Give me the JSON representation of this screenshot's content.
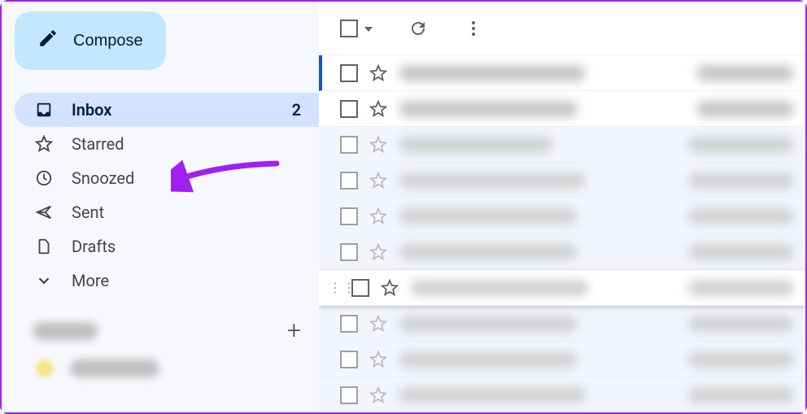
{
  "compose": {
    "label": "Compose"
  },
  "nav": {
    "items": [
      {
        "id": "inbox",
        "label": "Inbox",
        "count": "2",
        "active": true,
        "icon": "inbox-icon"
      },
      {
        "id": "starred",
        "label": "Starred",
        "count": "",
        "active": false,
        "icon": "star-icon"
      },
      {
        "id": "snoozed",
        "label": "Snoozed",
        "count": "",
        "active": false,
        "icon": "clock-icon"
      },
      {
        "id": "sent",
        "label": "Sent",
        "count": "",
        "active": false,
        "icon": "send-icon"
      },
      {
        "id": "drafts",
        "label": "Drafts",
        "count": "",
        "active": false,
        "icon": "file-icon"
      },
      {
        "id": "more",
        "label": "More",
        "count": "",
        "active": false,
        "icon": "chevron-down-icon"
      }
    ]
  },
  "annotation": {
    "target": "snoozed",
    "color": "#a020f0"
  },
  "messages": {
    "rows": [
      {
        "unread": true,
        "highlighted": true,
        "hovered": false,
        "senderWidth": 230,
        "subjectWidth": 120
      },
      {
        "unread": true,
        "highlighted": false,
        "hovered": false,
        "senderWidth": 220,
        "subjectWidth": 120
      },
      {
        "unread": false,
        "highlighted": false,
        "hovered": false,
        "senderWidth": 190,
        "subjectWidth": 130
      },
      {
        "unread": false,
        "highlighted": false,
        "hovered": false,
        "senderWidth": 230,
        "subjectWidth": 130
      },
      {
        "unread": false,
        "highlighted": false,
        "hovered": false,
        "senderWidth": 220,
        "subjectWidth": 130
      },
      {
        "unread": false,
        "highlighted": false,
        "hovered": false,
        "senderWidth": 220,
        "subjectWidth": 130
      },
      {
        "unread": false,
        "highlighted": false,
        "hovered": true,
        "senderWidth": 220,
        "subjectWidth": 130
      },
      {
        "unread": false,
        "highlighted": false,
        "hovered": false,
        "senderWidth": 220,
        "subjectWidth": 130
      },
      {
        "unread": false,
        "highlighted": false,
        "hovered": false,
        "senderWidth": 220,
        "subjectWidth": 130
      },
      {
        "unread": false,
        "highlighted": false,
        "hovered": false,
        "senderWidth": 230,
        "subjectWidth": 130
      }
    ]
  }
}
